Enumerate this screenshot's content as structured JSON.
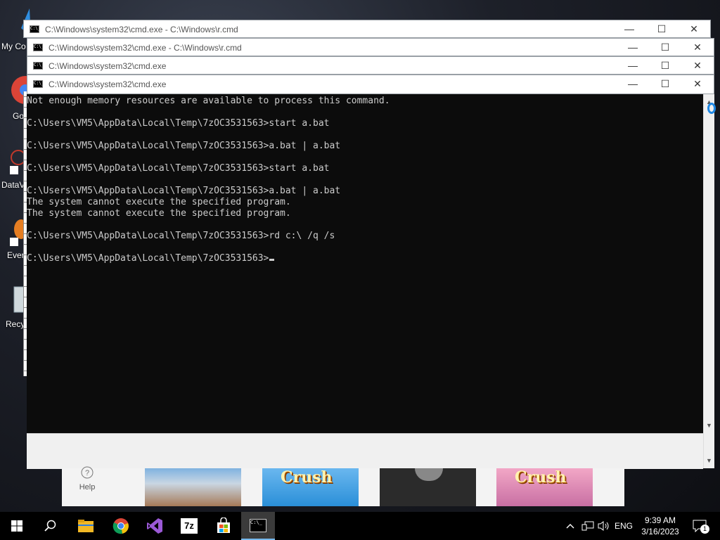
{
  "desktop": {
    "icons": [
      {
        "label": "My Co",
        "icon": "computer-icon"
      },
      {
        "label": "Go\nCh",
        "icon": "chrome-icon"
      },
      {
        "label": "DataV",
        "icon": "datav-icon"
      },
      {
        "label": "Ever",
        "icon": "everything-icon"
      },
      {
        "label": "Recy",
        "icon": "recycle-bin-icon"
      }
    ]
  },
  "windows": [
    {
      "title": "C:\\Windows\\system32\\cmd.exe - C:\\Windows\\r.cmd"
    },
    {
      "title": "C:\\Windows\\system32\\cmd.exe - C:\\Windows\\r.cmd"
    },
    {
      "title": "C:\\Windows\\system32\\cmd.exe"
    },
    {
      "title": "C:\\Windows\\system32\\cmd.exe"
    }
  ],
  "window_controls": {
    "minimize": "—",
    "maximize": "☐",
    "close": "✕"
  },
  "console": {
    "lines": [
      "Not enough memory resources are available to process this command.",
      "",
      "C:\\Users\\VM5\\AppData\\Local\\Temp\\7zOC3531563>start a.bat",
      "",
      "C:\\Users\\VM5\\AppData\\Local\\Temp\\7zOC3531563>a.bat | a.bat",
      "",
      "C:\\Users\\VM5\\AppData\\Local\\Temp\\7zOC3531563>start a.bat",
      "",
      "C:\\Users\\VM5\\AppData\\Local\\Temp\\7zOC3531563>a.bat | a.bat",
      "The system cannot execute the specified program.",
      "The system cannot execute the specified program.",
      "",
      "C:\\Users\\VM5\\AppData\\Local\\Temp\\7zOC3531563>rd c:\\ /q /s",
      "",
      "C:\\Users\\VM5\\AppData\\Local\\Temp\\7zOC3531563>"
    ]
  },
  "background_app": {
    "help_label": "Help",
    "tiles": [
      {
        "name": "roblox-tile"
      },
      {
        "name": "candy-crush-tile",
        "text": "Crush"
      },
      {
        "name": "dark-game-tile"
      },
      {
        "name": "candy-crush-saga-tile",
        "text": "Crush"
      }
    ]
  },
  "taskbar": {
    "apps": [
      "start-icon",
      "search-icon",
      "file-explorer-icon",
      "chrome-icon",
      "visual-studio-icon",
      "7zip-icon",
      "store-icon",
      "cmd-icon"
    ],
    "sevenzip_label": "7z",
    "language": "ENG",
    "time": "9:39 AM",
    "date": "3/16/2023",
    "notification_count": "1"
  },
  "colors": {
    "console_bg": "#0c0c0c",
    "console_fg": "#cccccc",
    "taskbar_bg": "#000000"
  }
}
